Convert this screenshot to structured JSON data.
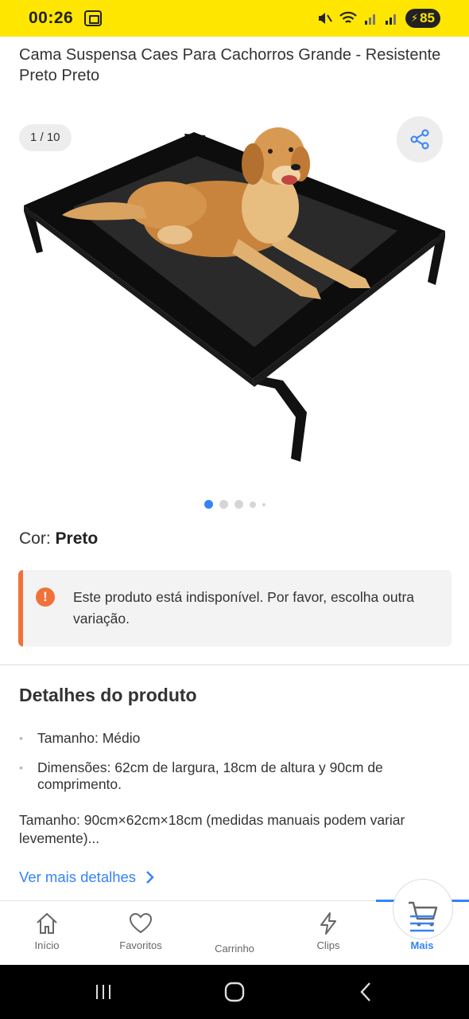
{
  "status_bar": {
    "time": "00:26",
    "battery": "85",
    "bg_color": "#ffe600"
  },
  "product": {
    "title": "Cama Suspensa Caes Para Cachorros Grande - Resistente Preto Preto",
    "image_counter": "1 / 10",
    "image_alt": "dog-on-elevated-bed-image",
    "color_label": "Cor:",
    "color_value": "Preto"
  },
  "alert": {
    "text": "Este produto está indisponível. Por favor, escolha outra variação.",
    "accent_color": "#f0723a"
  },
  "details": {
    "title": "Detalhes do produto",
    "bullets": [
      "Tamanho: Médio",
      "Dimensões: 62cm de largura, 18cm de altura y 90cm de comprimento."
    ],
    "description": "Tamanho: 90cm×62cm×18cm (medidas manuais podem variar levemente)...",
    "more_link": "Ver mais detalhes"
  },
  "nav": {
    "items": [
      {
        "label": "Início",
        "icon": "home-icon"
      },
      {
        "label": "Favoritos",
        "icon": "heart-icon"
      },
      {
        "label": "Carrinho",
        "icon": "cart-icon"
      },
      {
        "label": "Clips",
        "icon": "lightning-icon"
      },
      {
        "label": "Mais",
        "icon": "menu-icon"
      }
    ],
    "active_color": "#3483fa"
  }
}
